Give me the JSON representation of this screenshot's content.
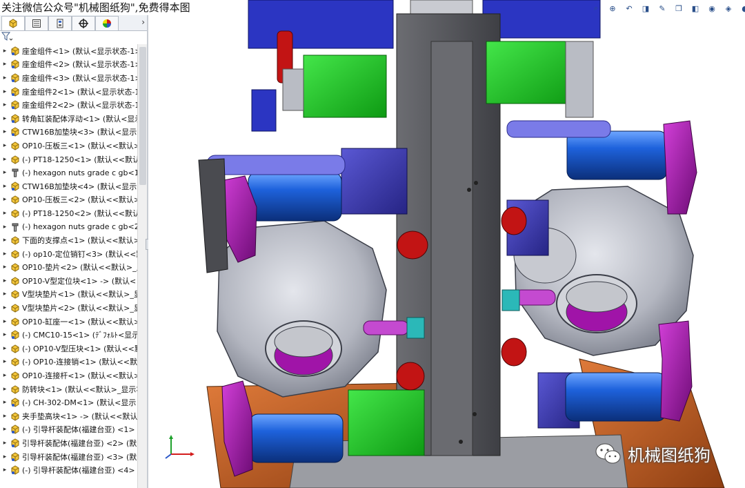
{
  "banner": {
    "text": "关注微信公众号\"机械图纸狗\",免费得本图"
  },
  "feature_manager": {
    "tabs": [
      "feature-tree",
      "property-manager",
      "configuration-manager",
      "dimxpert-manager",
      "display-manager"
    ],
    "tree_items": [
      {
        "label": "座金组件<1> (默认<显示状态-1>",
        "icon": "assembly"
      },
      {
        "label": "座金组件<2> (默认<显示状态-1>",
        "icon": "assembly"
      },
      {
        "label": "座金组件<3> (默认<显示状态-1>",
        "icon": "assembly"
      },
      {
        "label": "座金组件2<1> (默认<显示状态-1",
        "icon": "assembly"
      },
      {
        "label": "座金组件2<2> (默认<显示状态-1",
        "icon": "assembly"
      },
      {
        "label": "转角缸装配体浮动<1> (默认<显示",
        "icon": "assembly"
      },
      {
        "label": "CTW16B加垫块<3> (默认<显示",
        "icon": "assembly"
      },
      {
        "label": "OP10-压板三<1> (默认<<默认>",
        "icon": "part"
      },
      {
        "label": "(-) PT18-1250<1> (默认<<默认",
        "icon": "part"
      },
      {
        "label": "(-) hexagon nuts grade c gb<1",
        "icon": "fastener"
      },
      {
        "label": "CTW16B加垫块<4> (默认<显示",
        "icon": "assembly"
      },
      {
        "label": "OP10-压板三<2> (默认<<默认>",
        "icon": "part"
      },
      {
        "label": "(-) PT18-1250<2> (默认<<默认",
        "icon": "part"
      },
      {
        "label": "(-) hexagon nuts grade c gb<2",
        "icon": "fastener"
      },
      {
        "label": "下面的支撑点<1> (默认<<默认>",
        "icon": "part"
      },
      {
        "label": "(-) op10-定位销钉<3> (默认<<默",
        "icon": "part"
      },
      {
        "label": "OP10-垫片<2> (默认<<默认>_显",
        "icon": "part"
      },
      {
        "label": "OP10-V型定位块<1> -> (默认<",
        "icon": "part"
      },
      {
        "label": "V型块垫片<1> (默认<<默认>_显",
        "icon": "part"
      },
      {
        "label": "V型块垫片<2> (默认<<默认>_显",
        "icon": "part"
      },
      {
        "label": "OP10-缸座一<1> (默认<<默认>",
        "icon": "part"
      },
      {
        "label": "(-) CMC10-15<1> (ﾃﾞﾌｫﾙﾄ<显示",
        "icon": "assembly"
      },
      {
        "label": "(-) OP10-V型压块<1> (默认<<默",
        "icon": "part"
      },
      {
        "label": "(-) OP10-连接销<1> (默认<<默认",
        "icon": "part"
      },
      {
        "label": "OP10-连接杆<1> (默认<<默认>",
        "icon": "part"
      },
      {
        "label": "防转块<1> (默认<<默认>_显示状",
        "icon": "part"
      },
      {
        "label": "(-) CH-302-DM<1> (默认<显示",
        "icon": "assembly"
      },
      {
        "label": "夹手垫高块<1> -> (默认<<默认",
        "icon": "part"
      },
      {
        "label": "(-) 引导杆装配体(福建台亚) <1>",
        "icon": "assembly"
      },
      {
        "label": "引导杆装配体(福建台亚) <2> (默",
        "icon": "assembly"
      },
      {
        "label": "引导杆装配体(福建台亚) <3> (默",
        "icon": "assembly"
      },
      {
        "label": "(-) 引导杆装配体(福建台亚) <4>",
        "icon": "assembly"
      }
    ]
  },
  "heads_up_toolbar": [
    "zoom-to-fit-icon",
    "zoom-area-icon",
    "previous-view-icon",
    "section-view-icon",
    "dynamic-annotation-icon",
    "view-orientation-icon",
    "display-style-icon",
    "hide-show-icon",
    "edit-appearance-icon",
    "apply-scene-icon",
    "view-settings-icon"
  ],
  "watermark": {
    "text": "机械图纸狗"
  },
  "colors": {
    "blue_cylinder": "#1c5fd6",
    "magenta_clamp": "#a21aa8",
    "green_block": "#19c21c",
    "purple_block": "#3a3aa8",
    "gray_plate": "#5f6064",
    "orange_base": "#c7652a",
    "red_stop": "#c21414",
    "housing_gray": "#b8bac2"
  }
}
